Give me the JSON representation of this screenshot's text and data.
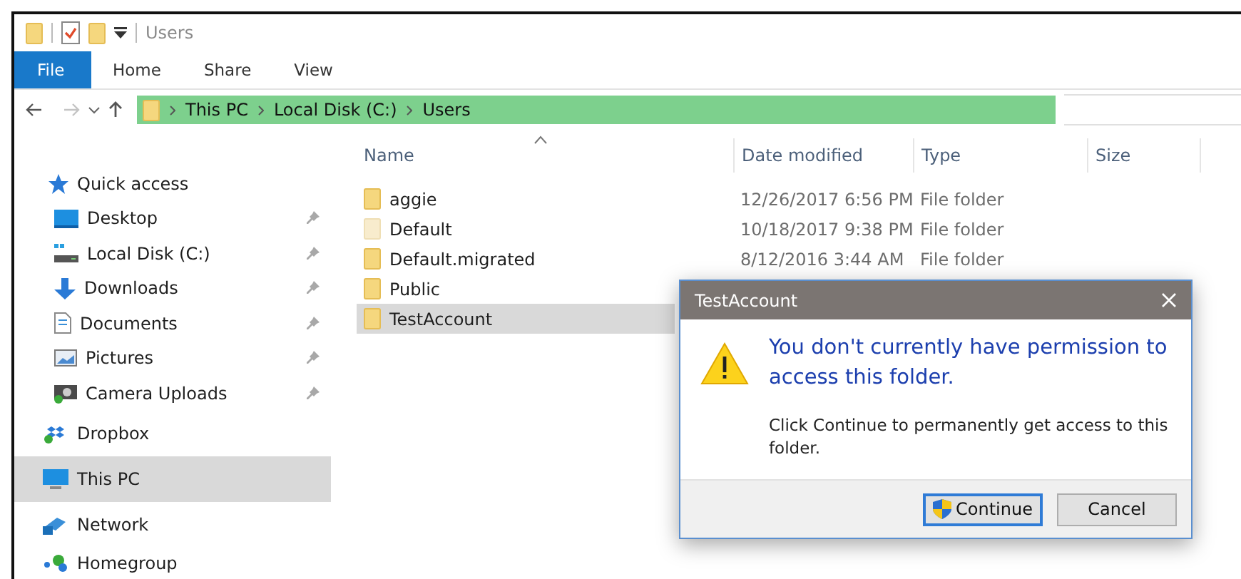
{
  "title_bar": {
    "title": "Users"
  },
  "ribbon_tabs": [
    {
      "label": "File",
      "kind": "backstage"
    },
    {
      "label": "Home",
      "kind": "tab"
    },
    {
      "label": "Share",
      "kind": "tab"
    },
    {
      "label": "View",
      "kind": "tab"
    }
  ],
  "address_bar": {
    "path": [
      "This PC",
      "Local Disk (C:)",
      "Users"
    ]
  },
  "sidebar": {
    "items": [
      {
        "label": "Quick access",
        "selected": false,
        "children": [
          {
            "label": "Desktop",
            "pinned": true,
            "selected": false
          },
          {
            "label": "Local Disk (C:)",
            "pinned": true,
            "selected": false
          },
          {
            "label": "Downloads",
            "pinned": true,
            "selected": false
          },
          {
            "label": "Documents",
            "pinned": true,
            "selected": false
          },
          {
            "label": "Pictures",
            "pinned": true,
            "selected": false
          },
          {
            "label": "Camera Uploads",
            "pinned": true,
            "selected": false
          }
        ]
      },
      {
        "label": "Dropbox",
        "selected": false
      },
      {
        "label": "This PC",
        "selected": true
      },
      {
        "label": "Network",
        "selected": false
      },
      {
        "label": "Homegroup",
        "selected": false
      }
    ]
  },
  "table": {
    "columns": [
      {
        "label": "Name",
        "sorted": true
      },
      {
        "label": "Date modified",
        "sorted": false
      },
      {
        "label": "Type",
        "sorted": false
      },
      {
        "label": "Size",
        "sorted": false
      }
    ],
    "rows": [
      {
        "name": "aggie",
        "date": "12/26/2017 6:56 PM",
        "type": "File folder",
        "hidden": false,
        "selected": false
      },
      {
        "name": "Default",
        "date": "10/18/2017 9:38 PM",
        "type": "File folder",
        "hidden": true,
        "selected": false
      },
      {
        "name": "Default.migrated",
        "date": "8/12/2016 3:44 AM",
        "type": "File folder",
        "hidden": false,
        "selected": false
      },
      {
        "name": "Public",
        "hidden": false,
        "selected": false
      },
      {
        "name": "TestAccount",
        "hidden": false,
        "selected": true
      }
    ]
  },
  "dialog": {
    "title": "TestAccount",
    "heading": "You don't currently have permission to access this folder.",
    "message": "Click Continue to permanently get access to this folder.",
    "buttons": [
      {
        "label": "Continue",
        "kind": "primary"
      },
      {
        "label": "Cancel",
        "kind": "secondary"
      }
    ]
  }
}
